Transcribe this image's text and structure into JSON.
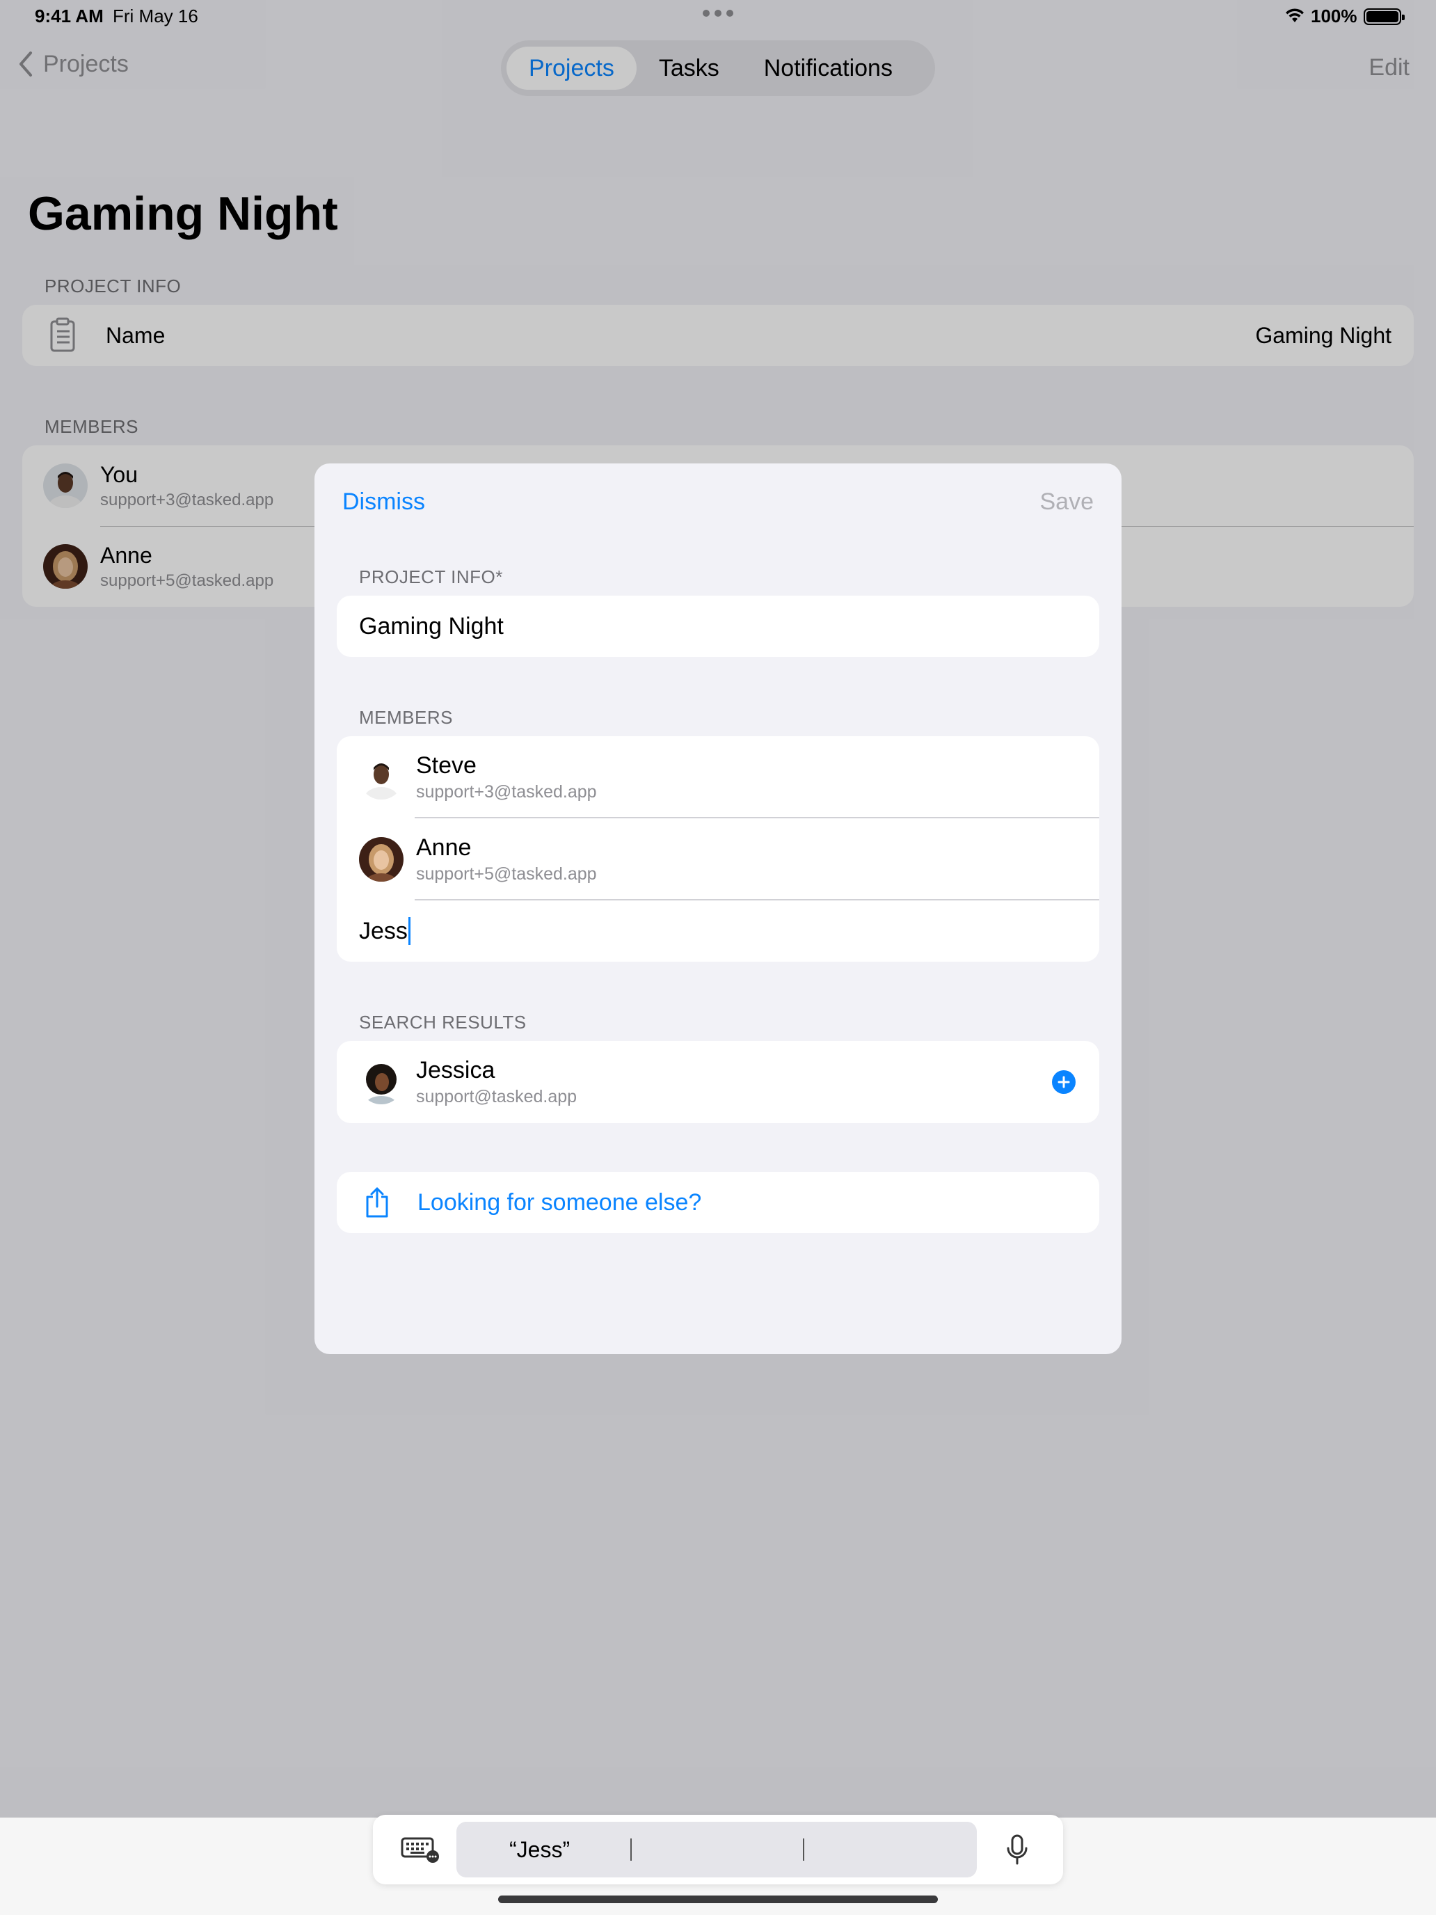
{
  "status_bar": {
    "time": "9:41 AM",
    "date": "Fri May 16",
    "battery": "100%"
  },
  "nav": {
    "back_label": "Projects",
    "tabs": [
      {
        "label": "Projects",
        "active": true
      },
      {
        "label": "Tasks",
        "active": false
      },
      {
        "label": "Notifications",
        "active": false
      }
    ],
    "edit_label": "Edit"
  },
  "background": {
    "title": "Gaming Night",
    "project_info_header": "PROJECT INFO",
    "info_rows": [
      {
        "label": "Name",
        "value": "Gaming Night",
        "icon": "clipboard-icon"
      }
    ],
    "members_header": "MEMBERS",
    "members": [
      {
        "name": "You",
        "email": "support+3@tasked.app"
      },
      {
        "name": "Anne",
        "email": "support+5@tasked.app"
      }
    ]
  },
  "modal": {
    "dismiss_label": "Dismiss",
    "save_label": "Save",
    "project_info_header": "PROJECT INFO*",
    "project_name_value": "Gaming Night",
    "members_header": "MEMBERS",
    "members": [
      {
        "name": "Steve",
        "email": "support+3@tasked.app"
      },
      {
        "name": "Anne",
        "email": "support+5@tasked.app"
      }
    ],
    "search_value": "Jess",
    "search_results_header": "SEARCH RESULTS",
    "search_results": [
      {
        "name": "Jessica",
        "email": "support@tasked.app",
        "action_icon": "plus-circle-icon"
      }
    ],
    "other_label": "Looking for someone else?",
    "other_icon": "share-icon"
  },
  "keyboard_bar": {
    "suggestion": "“Jess”",
    "left_icon": "keyboard-icon",
    "right_icon": "microphone-icon"
  },
  "colors": {
    "accent": "#0a84ff",
    "background": "#f2f2f7",
    "secondary_text": "#8e8e93"
  }
}
